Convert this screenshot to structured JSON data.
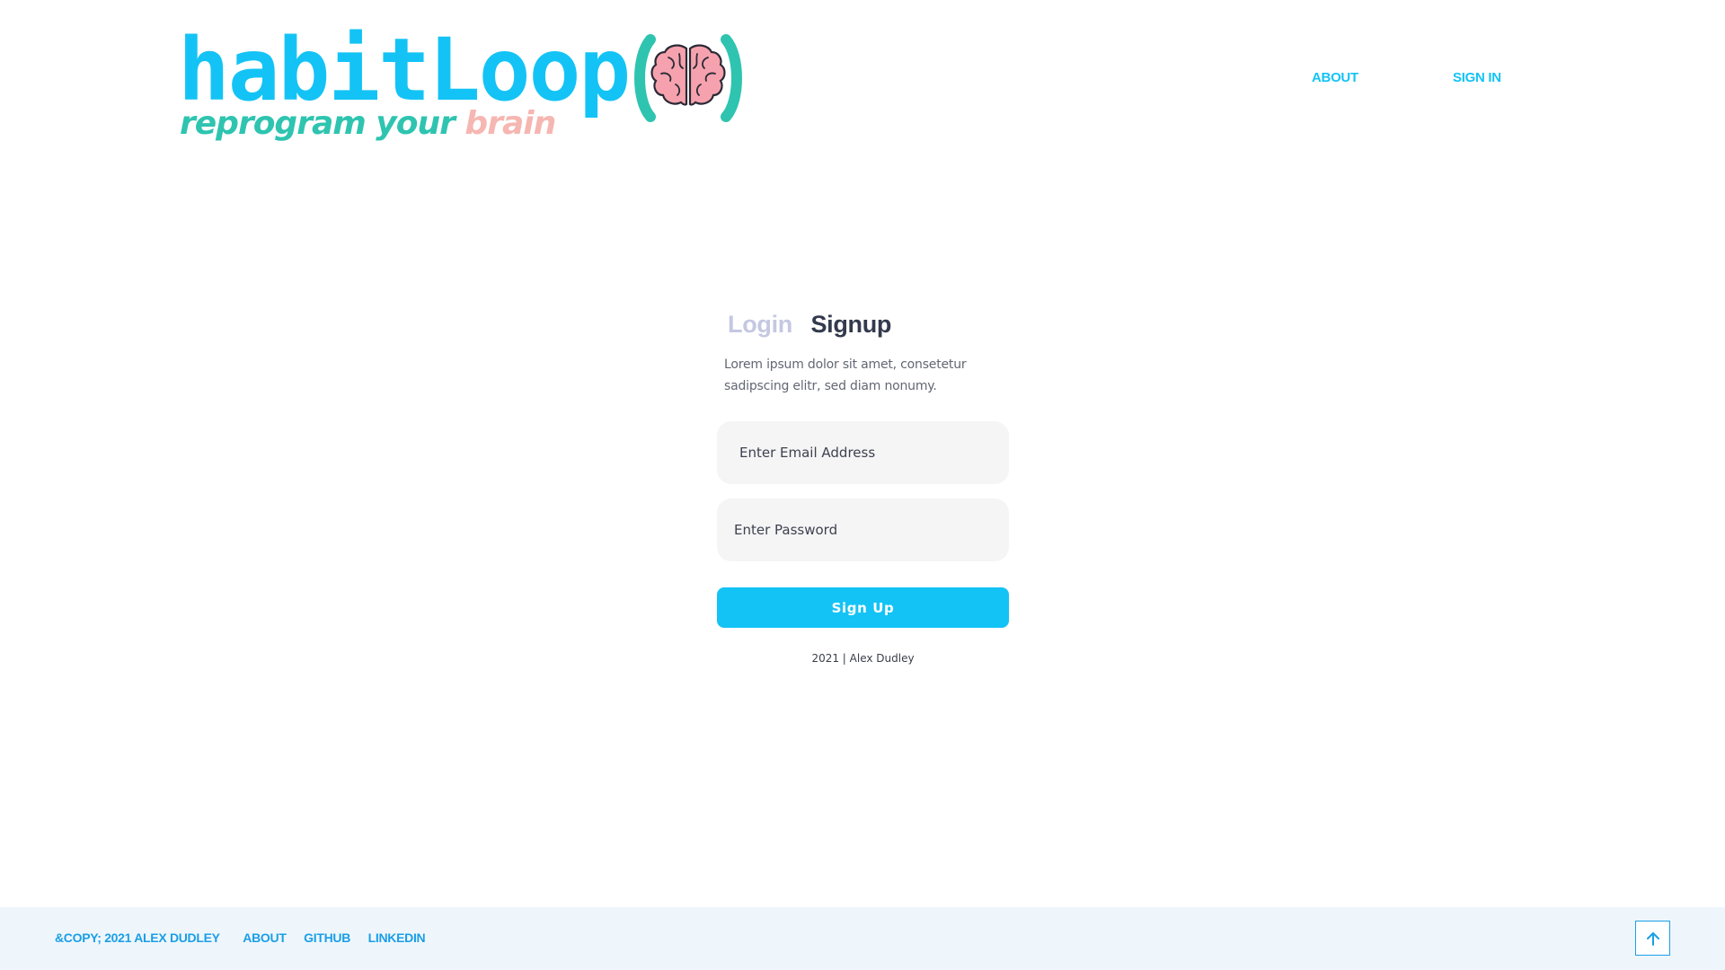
{
  "brand": {
    "name": "habitLoop",
    "tagline_part1": "reprogram your",
    "tagline_part2": "brain",
    "brain_icon": "brain-icon",
    "colors": {
      "primary": "#14c3f5",
      "teal": "#2ec4b0",
      "pink": "#f6b6b1"
    }
  },
  "nav": {
    "about": "ABOUT",
    "sign_in": "SIGN IN"
  },
  "auth": {
    "tabs": [
      {
        "label": "Login",
        "active": false
      },
      {
        "label": "Signup",
        "active": true
      }
    ],
    "description": "Lorem ipsum dolor sit amet, consetetur sadipscing elitr, sed diam nonumy.",
    "email_placeholder": "Enter Email Address",
    "password_placeholder": "Enter Password",
    "submit_label": "Sign Up",
    "credit": "2021 | Alex Dudley"
  },
  "footer": {
    "copyright": "&COPY; 2021 ALEX DUDLEY",
    "links": [
      "ABOUT",
      "GITHUB",
      "LINKEDIN"
    ],
    "back_to_top_icon": "arrow-up-icon"
  }
}
